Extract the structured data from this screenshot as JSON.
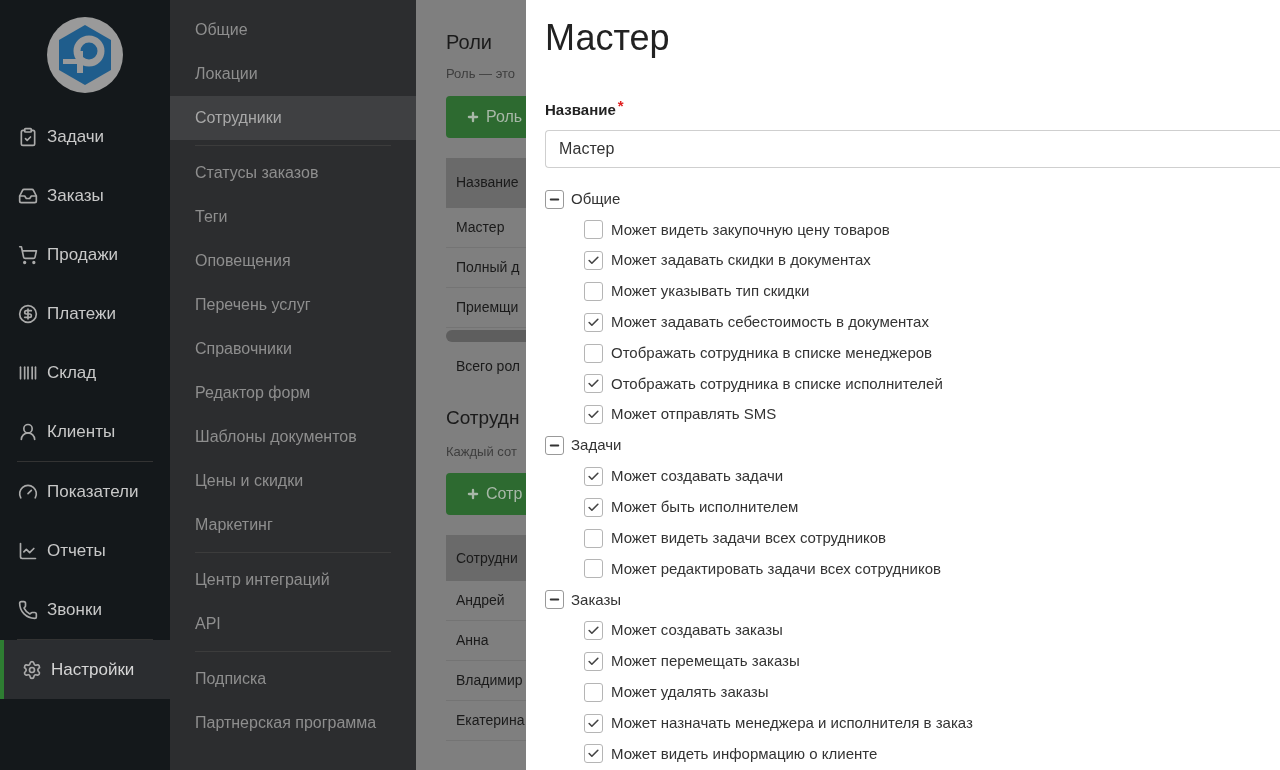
{
  "nav": [
    {
      "label": "Задачи",
      "selected": false
    },
    {
      "label": "Заказы",
      "selected": false
    },
    {
      "label": "Продажи",
      "selected": false
    },
    {
      "label": "Платежи",
      "selected": false
    },
    {
      "label": "Склад",
      "selected": false
    },
    {
      "label": "Клиенты",
      "selected": false,
      "divider_after": true
    },
    {
      "label": "Показатели",
      "selected": false
    },
    {
      "label": "Отчеты",
      "selected": false
    },
    {
      "label": "Звонки",
      "selected": false,
      "divider_after": true
    },
    {
      "label": "Настройки",
      "selected": true
    }
  ],
  "submenu": [
    {
      "label": "Общие",
      "selected": false
    },
    {
      "label": "Локации",
      "selected": false
    },
    {
      "label": "Сотрудники",
      "selected": true,
      "divider_after": true
    },
    {
      "label": "Статусы заказов",
      "selected": false
    },
    {
      "label": "Теги",
      "selected": false
    },
    {
      "label": "Оповещения",
      "selected": false
    },
    {
      "label": "Перечень услуг",
      "selected": false
    },
    {
      "label": "Справочники",
      "selected": false
    },
    {
      "label": "Редактор форм",
      "selected": false
    },
    {
      "label": "Шаблоны документов",
      "selected": false
    },
    {
      "label": "Цены и скидки",
      "selected": false
    },
    {
      "label": "Маркетинг",
      "selected": false,
      "divider_after": true
    },
    {
      "label": "Центр интеграций",
      "selected": false
    },
    {
      "label": "API",
      "selected": false,
      "divider_after": true
    },
    {
      "label": "Подписка",
      "selected": false
    },
    {
      "label": "Партнерская программа",
      "selected": false
    }
  ],
  "background_page": {
    "roles_title": "Роли",
    "roles_hint": "Роль — это",
    "roles_button": "Роль",
    "roles_header": "Название",
    "roles_rows": [
      "Мастер",
      "Полный д",
      "Приемщи"
    ],
    "roles_total": "Всего рол",
    "staff_title": "Сотрудн",
    "staff_hint": "Каждый сот",
    "staff_button": "Сотр",
    "staff_header": "Сотрудни",
    "staff_rows": [
      "Андрей",
      "Анна",
      "Владимир",
      "Екатерина"
    ]
  },
  "panel": {
    "title": "Мастер",
    "name_label": "Название",
    "required_mark": "*",
    "name_value": "Мастер",
    "groups": [
      {
        "label": "Общие",
        "expanded": true,
        "items": [
          {
            "label": "Может видеть закупочную цену товаров",
            "checked": false
          },
          {
            "label": "Может задавать скидки в документах",
            "checked": true
          },
          {
            "label": "Может указывать тип скидки",
            "checked": false
          },
          {
            "label": "Может задавать себестоимость в документах",
            "checked": true
          },
          {
            "label": "Отображать сотрудника в списке менеджеров",
            "checked": false
          },
          {
            "label": "Отображать сотрудника в списке исполнителей",
            "checked": true
          },
          {
            "label": "Может отправлять SMS",
            "checked": true
          }
        ]
      },
      {
        "label": "Задачи",
        "expanded": true,
        "items": [
          {
            "label": "Может создавать задачи",
            "checked": true
          },
          {
            "label": "Может быть исполнителем",
            "checked": true
          },
          {
            "label": "Может видеть задачи всех сотрудников",
            "checked": false
          },
          {
            "label": "Может редактировать задачи всех сотрудников",
            "checked": false
          }
        ]
      },
      {
        "label": "Заказы",
        "expanded": true,
        "items": [
          {
            "label": "Может создавать заказы",
            "checked": true
          },
          {
            "label": "Может перемещать заказы",
            "checked": true
          },
          {
            "label": "Может удалять заказы",
            "checked": false
          },
          {
            "label": "Может назначать менеджера и исполнителя в заказ",
            "checked": true
          },
          {
            "label": "Может видеть информацию о клиенте",
            "checked": true
          }
        ]
      }
    ]
  }
}
